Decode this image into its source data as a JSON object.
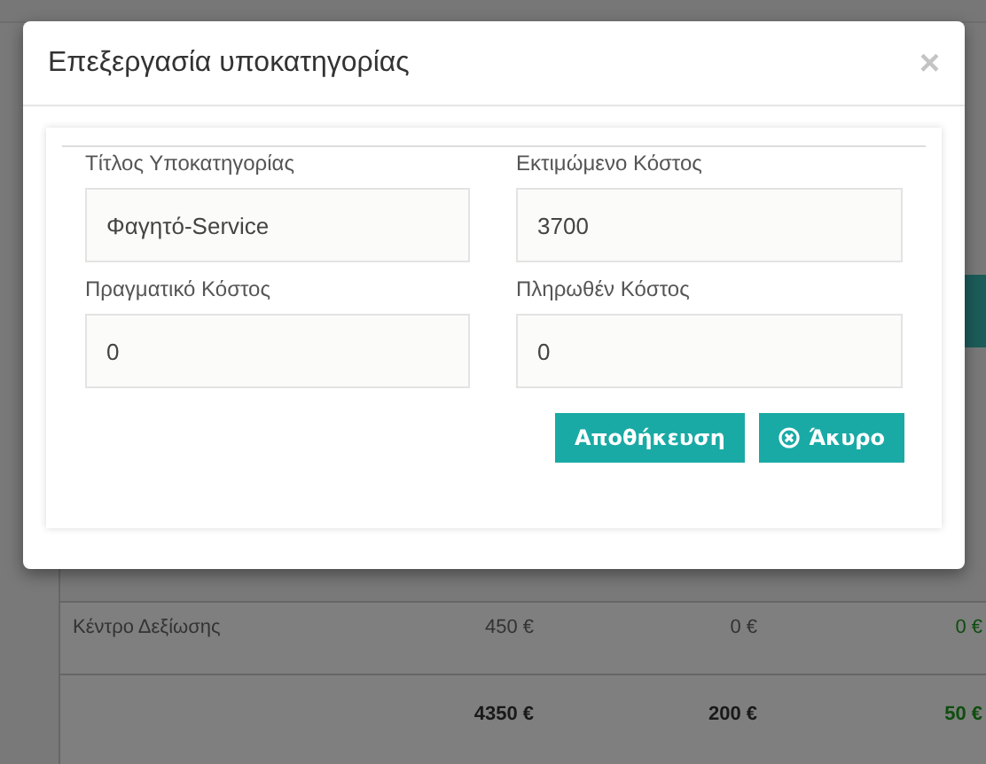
{
  "background": {
    "rows": [
      {
        "kind": "item",
        "name": "Κέντρο Δεξίωσης",
        "values": [
          "450 €",
          "0 €",
          "0 €"
        ]
      },
      {
        "kind": "total",
        "values": [
          "4350 €",
          "200 €",
          "50 €"
        ]
      }
    ]
  },
  "dialog": {
    "title": "Επεξεργασία υποκατηγορίας",
    "close": "×",
    "fields": [
      {
        "label": "Τίτλος Υποκατηγορίας",
        "value": "Φαγητό-Service"
      },
      {
        "label": "Εκτιμώμενο Κόστος",
        "value": "3700"
      },
      {
        "label": "Πραγματικό Κόστος",
        "value": "0"
      },
      {
        "label": "Πληρωθέν Κόστος",
        "value": "0"
      }
    ],
    "buttons": [
      {
        "kind": "save",
        "label": "Αποθήκευση"
      },
      {
        "kind": "cancel",
        "label": "Άκυρο"
      }
    ]
  }
}
